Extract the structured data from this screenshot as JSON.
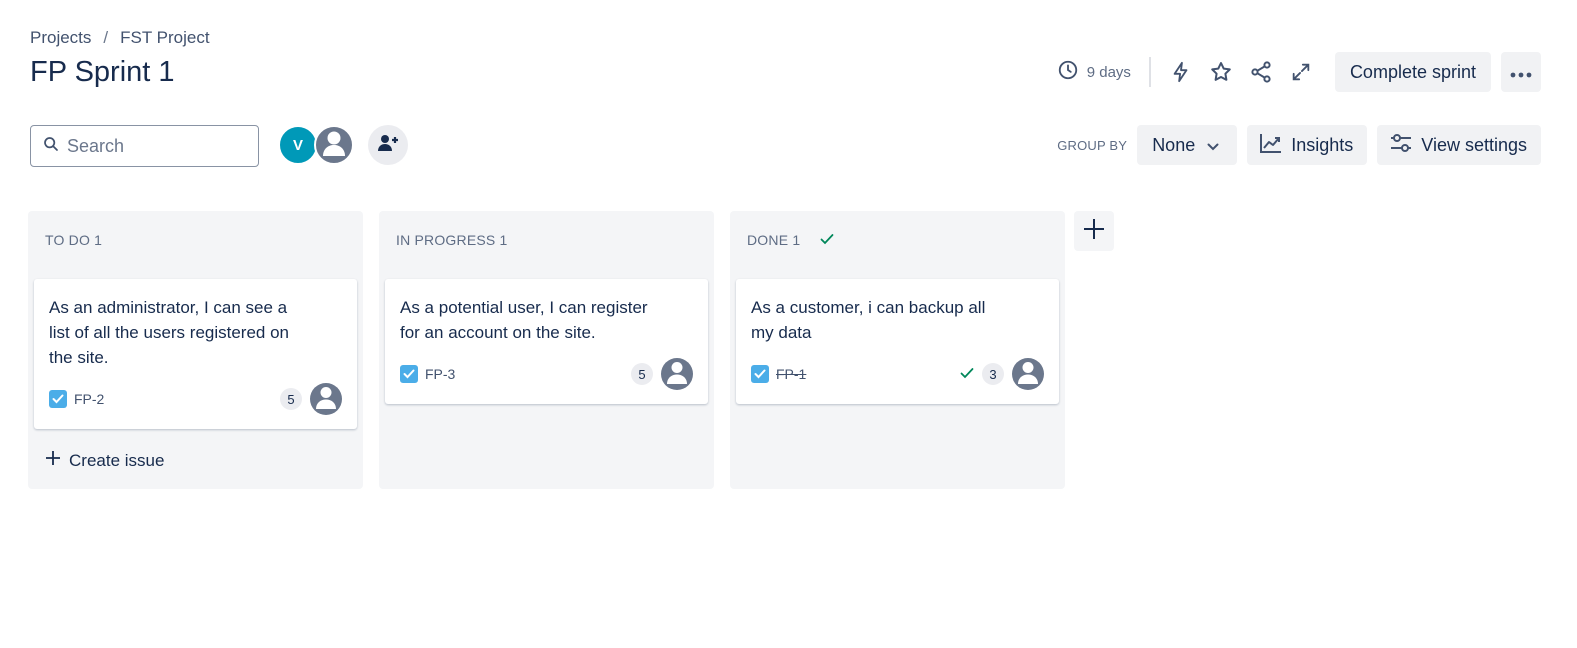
{
  "breadcrumb": {
    "projects": "Projects",
    "separator": "/",
    "project": "FST Project"
  },
  "title": "FP Sprint 1",
  "header": {
    "days_remaining": "9 days",
    "complete_sprint_label": "Complete sprint"
  },
  "toolbar": {
    "search_placeholder": "Search",
    "avatar_initial": "V",
    "group_by_label": "GROUP BY",
    "group_by_value": "None",
    "insights_label": "Insights",
    "view_settings_label": "View settings"
  },
  "columns": [
    {
      "title": "TO DO 1",
      "card": {
        "summary": "As an administrator, I can see a list of all the users registered on the site.",
        "key": "FP-2",
        "points": "5"
      },
      "create_issue_label": "Create issue"
    },
    {
      "title": "IN PROGRESS 1",
      "card": {
        "summary": "As a potential user, I can register for an account on the site.",
        "key": "FP-3",
        "points": "5"
      }
    },
    {
      "title": "DONE 1",
      "card": {
        "summary": "As a customer, i can backup all my data",
        "key": "FP-1",
        "points": "3"
      }
    }
  ],
  "colors": {
    "accent": "#0099b8",
    "story": "#4bade8",
    "done": "#00875a",
    "text": "#172b4d"
  },
  "icons": [
    "clock-icon",
    "lightning-icon",
    "star-icon",
    "share-icon",
    "expand-icon",
    "more-icon",
    "search-icon",
    "add-people-icon",
    "chevron-down-icon",
    "insights-icon",
    "settings-icon",
    "plus-icon",
    "story-icon",
    "check-icon",
    "user-icon"
  ]
}
